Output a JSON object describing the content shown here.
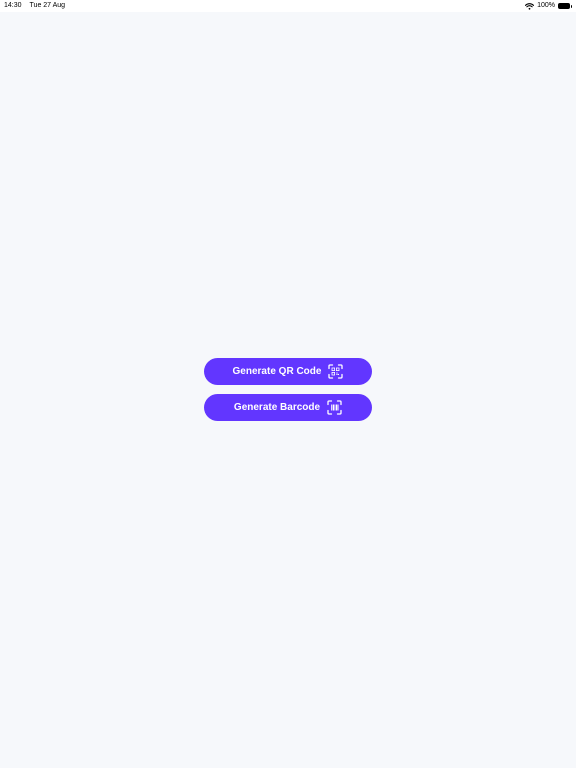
{
  "status_bar": {
    "time": "14:30",
    "date": "Tue 27 Aug",
    "battery_level": "100%",
    "icons": {
      "wifi": "wifi-icon",
      "battery": "battery-icon"
    }
  },
  "actions": {
    "generate_qr_label": "Generate QR Code",
    "generate_barcode_label": "Generate Barcode",
    "icons": {
      "qr": "qr-code-scan-icon",
      "barcode": "barcode-scan-icon"
    }
  },
  "colors": {
    "background": "#f6f8fb",
    "button_primary": "#6236ff",
    "button_text": "#ffffff"
  }
}
